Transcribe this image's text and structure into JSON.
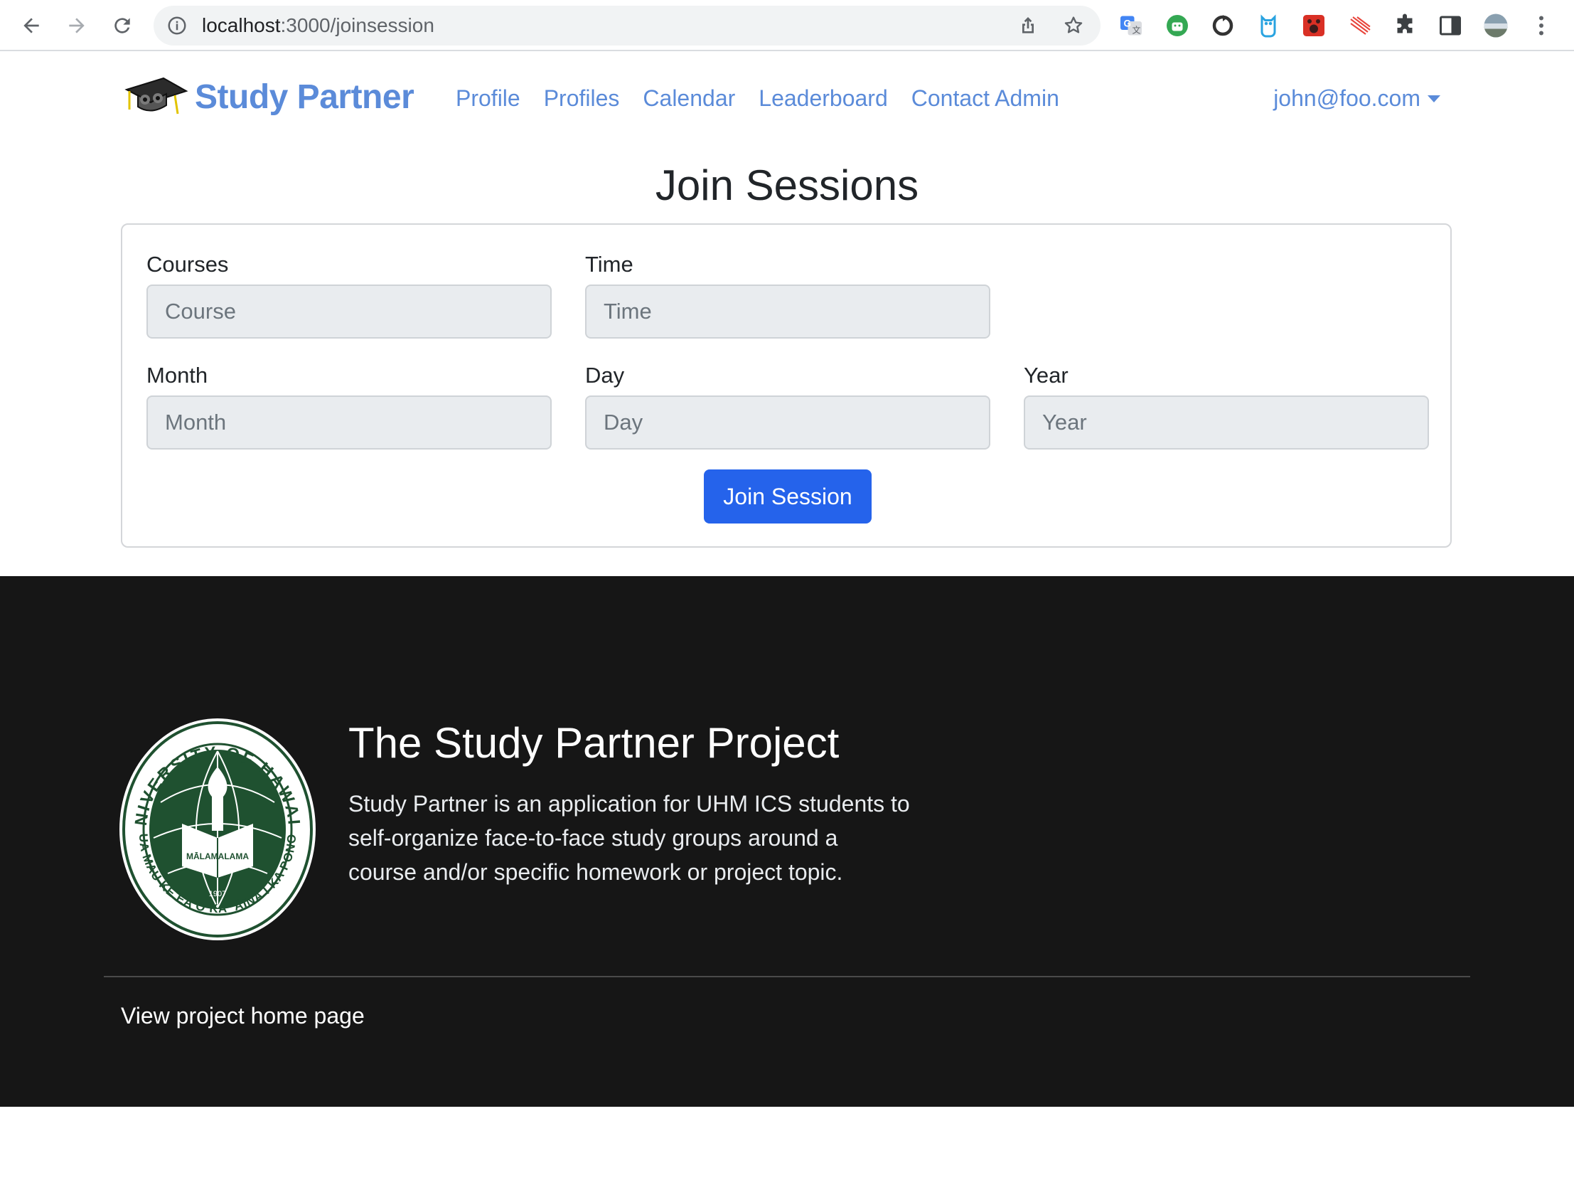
{
  "browser": {
    "url_host": "localhost",
    "url_path": ":3000/joinsession",
    "icons": [
      "back-arrow-icon",
      "forward-arrow-icon",
      "reload-icon",
      "info-icon",
      "share-icon",
      "bookmark-star-icon",
      "google-translate-icon",
      "android-extension-icon",
      "sync-extension-icon",
      "owl-extension-icon",
      "paw-extension-icon",
      "stripes-extension-icon",
      "puzzle-extensions-icon",
      "side-panel-icon",
      "profile-avatar-icon",
      "kebab-menu-icon"
    ]
  },
  "navbar": {
    "brand": "Study Partner",
    "links": [
      "Profile",
      "Profiles",
      "Calendar",
      "Leaderboard",
      "Contact Admin"
    ],
    "user": "john@foo.com"
  },
  "page": {
    "title": "Join Sessions"
  },
  "form": {
    "courses": {
      "label": "Courses",
      "placeholder": "Course"
    },
    "time": {
      "label": "Time",
      "placeholder": "Time"
    },
    "month": {
      "label": "Month",
      "placeholder": "Month"
    },
    "day": {
      "label": "Day",
      "placeholder": "Day"
    },
    "year": {
      "label": "Year",
      "placeholder": "Year"
    },
    "submit": "Join Session"
  },
  "footer": {
    "title": "The Study Partner Project",
    "description": "Study Partner is an application for UHM ICS students to self-organize face-to-face study groups around a course and/or specific homework or project topic.",
    "link": "View project home page",
    "seal": {
      "top_text": "UNIVERSITY OF HAWAI‘I",
      "bottom_text": "UA MAU KE EA O KA ‘ĀINA I KA PONO",
      "book_text": "MĀLAMALAMA",
      "year": "1907"
    }
  },
  "colors": {
    "link": "#5b8bd9",
    "primary_button": "#2563eb",
    "footer_bg": "#161616",
    "seal_green": "#1f5130"
  }
}
